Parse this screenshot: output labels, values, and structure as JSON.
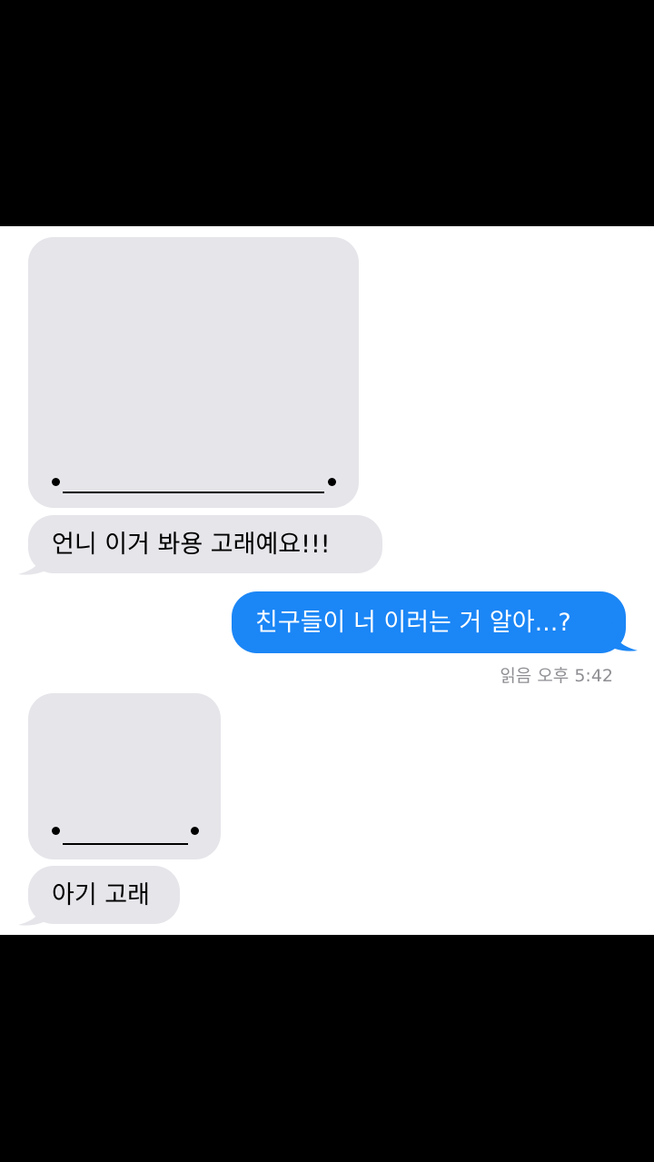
{
  "messages": {
    "msg1_text": "언니 이거 봐용 고래예요!!!",
    "msg2_text": "친구들이 너 이러는 거 알아...?",
    "msg2_receipt": "읽음 오후 5:42",
    "msg3_text": "아기 고래"
  },
  "colors": {
    "incoming_bubble": "#e5e5ea",
    "outgoing_bubble": "#1b86f6",
    "receipt_text": "#8e8e93"
  }
}
